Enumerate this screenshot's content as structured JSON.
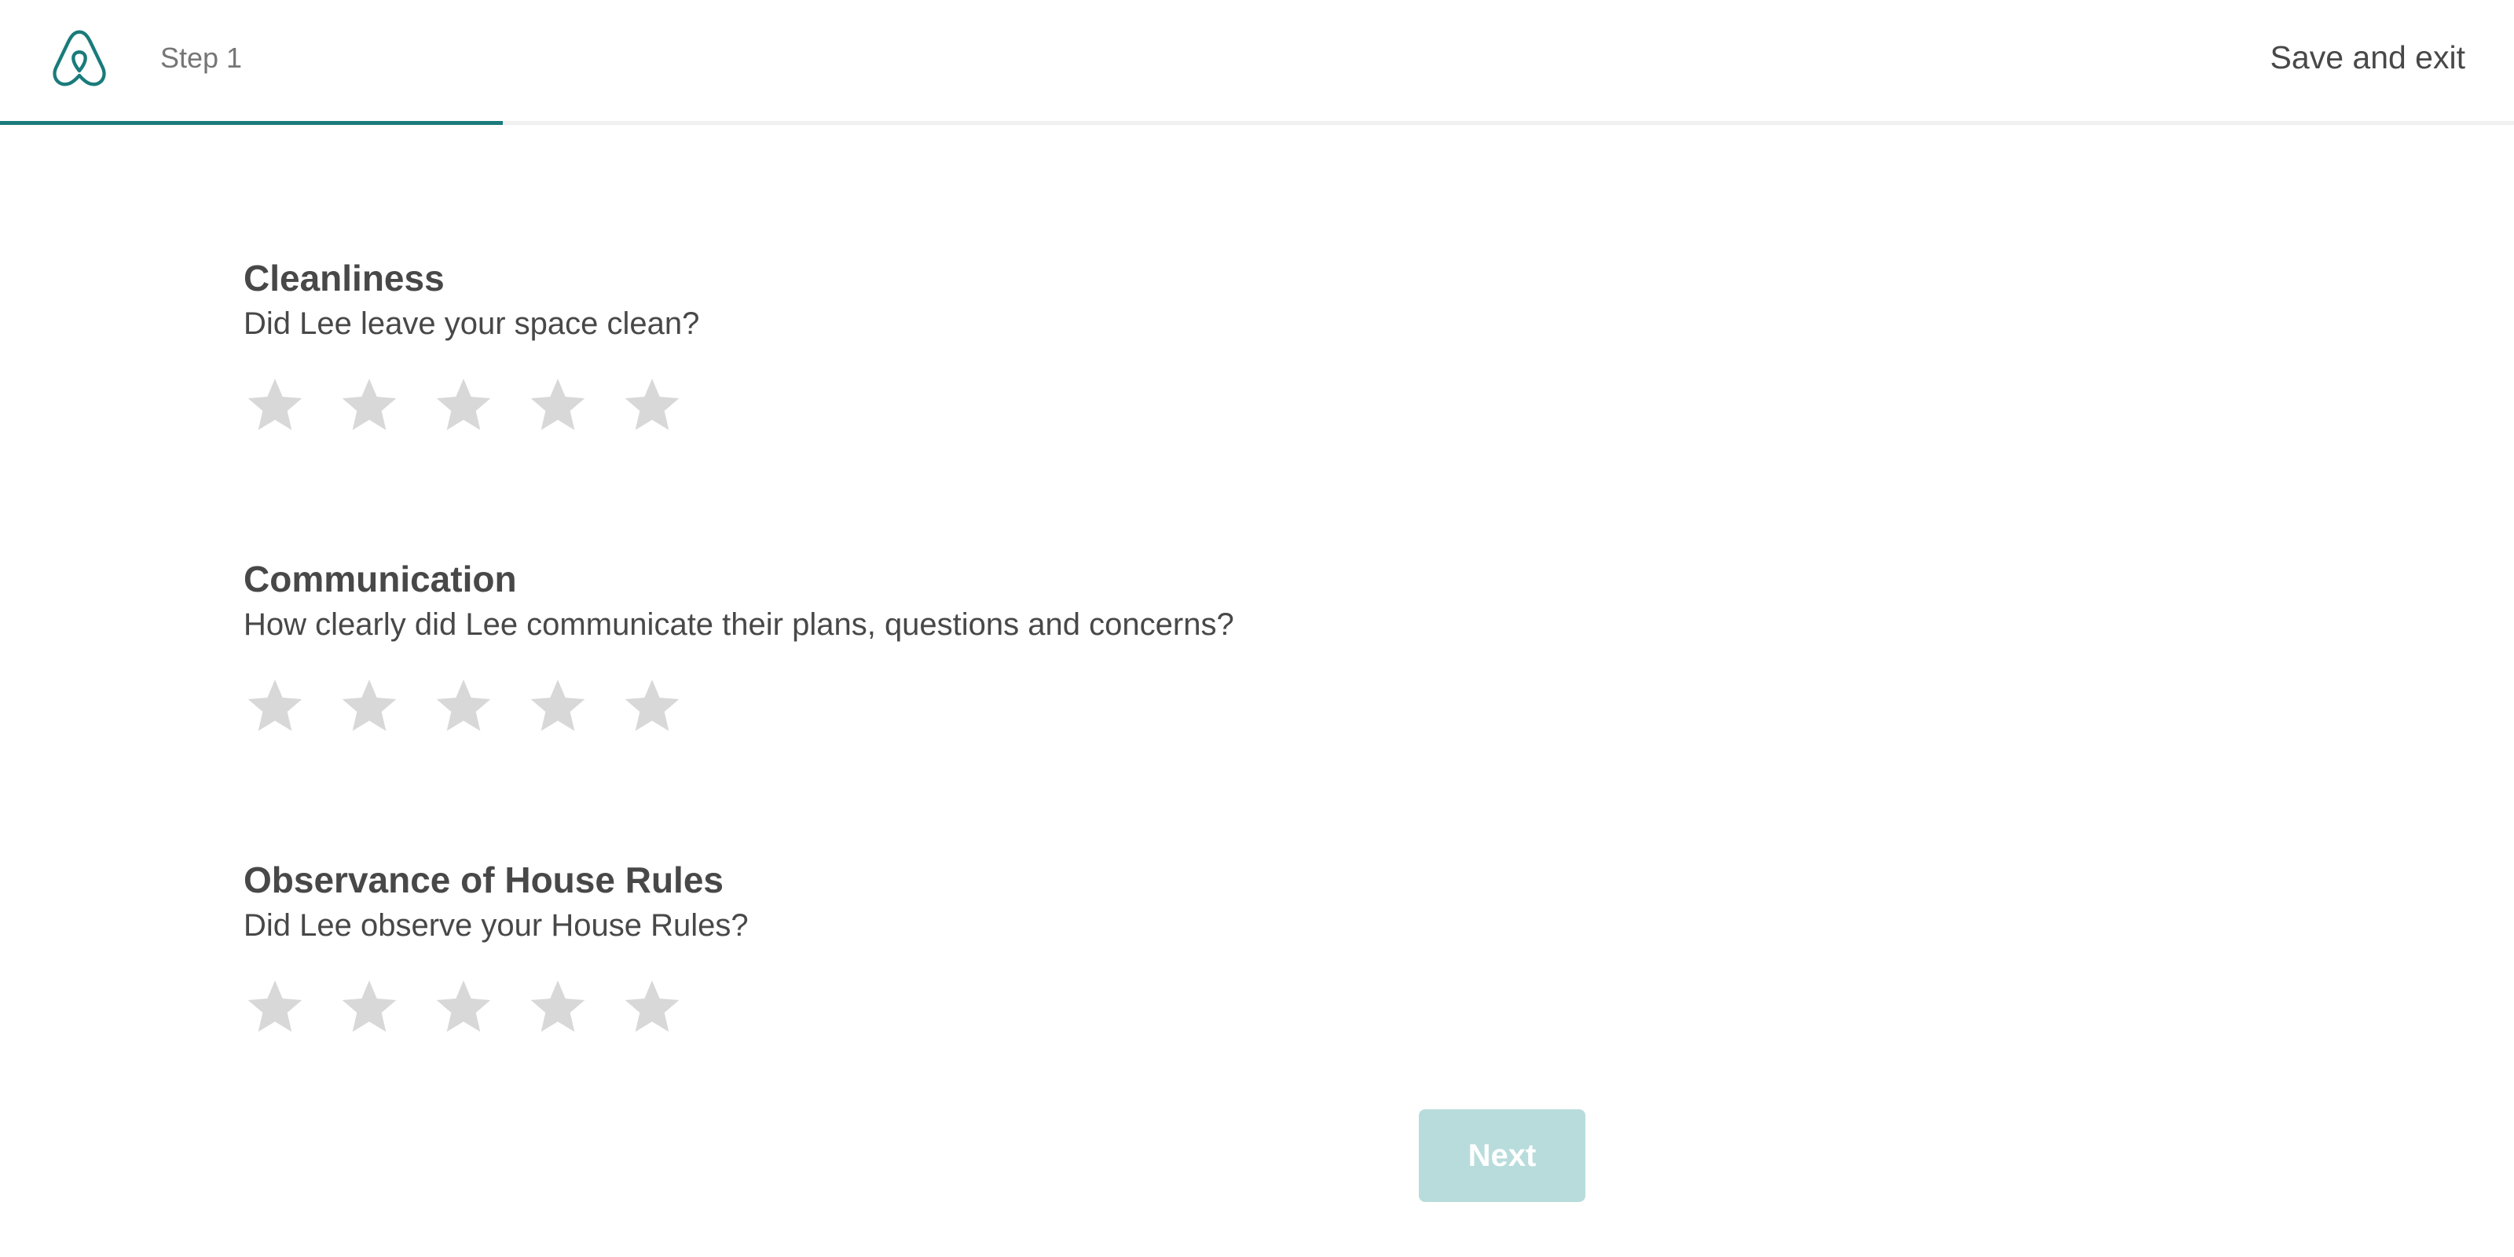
{
  "header": {
    "logo_icon": "airbnb-logo-icon",
    "step_label": "Step 1",
    "save_exit_label": "Save and exit",
    "progress_fraction": 0.2
  },
  "colors": {
    "accent": "#1a7b7b",
    "star_empty": "#d8d8d8",
    "button_disabled": "#b8dcdc"
  },
  "sections": [
    {
      "title": "Cleanliness",
      "question": "Did Lee leave your space clean?",
      "rating": 0,
      "max_rating": 5
    },
    {
      "title": "Communication",
      "question": "How clearly did Lee communicate their plans, questions and concerns?",
      "rating": 0,
      "max_rating": 5
    },
    {
      "title": "Observance of House Rules",
      "question": "Did Lee observe your House Rules?",
      "rating": 0,
      "max_rating": 5
    }
  ],
  "footer": {
    "next_label": "Next"
  }
}
